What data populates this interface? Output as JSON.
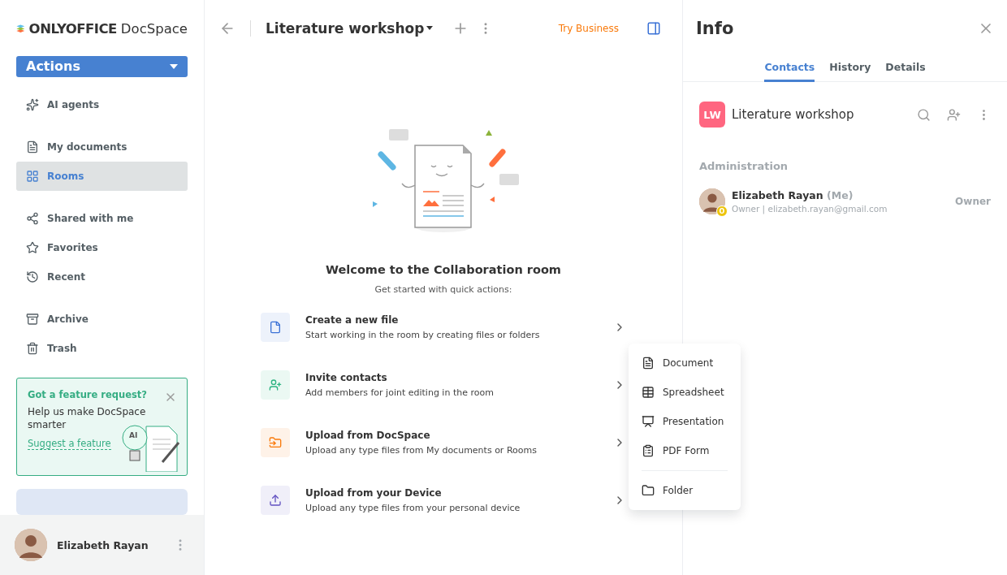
{
  "logo": {
    "brand": "ONLYOFFICE",
    "product": "DocSpace"
  },
  "actions_button": {
    "label": "Actions"
  },
  "sidebar": {
    "groups": [
      [
        {
          "label": "AI agents",
          "selected": false
        }
      ],
      [
        {
          "label": "My documents",
          "selected": false
        },
        {
          "label": "Rooms",
          "selected": true
        }
      ],
      [
        {
          "label": "Shared with me",
          "selected": false
        },
        {
          "label": "Favorites",
          "selected": false
        },
        {
          "label": "Recent",
          "selected": false
        }
      ],
      [
        {
          "label": "Archive",
          "selected": false
        },
        {
          "label": "Trash",
          "selected": false
        }
      ]
    ]
  },
  "feature_card": {
    "title": "Got a feature request?",
    "text": "Help us make DocSpace smarter",
    "link": "Suggest a feature",
    "badge": "AI"
  },
  "user": {
    "name": "Elizabeth Rayan"
  },
  "header": {
    "title": "Literature workshop",
    "try_business": "Try Business"
  },
  "empty_state": {
    "title": "Welcome to the Collaboration room",
    "subtitle": "Get started with quick actions:"
  },
  "quick_actions": [
    {
      "title": "Create a new file",
      "description": "Start working in the room by creating files or folders",
      "color": "#3b72d6"
    },
    {
      "title": "Invite contacts",
      "description": "Add members for joint editing in the room",
      "color": "#2db482"
    },
    {
      "title": "Upload from DocSpace",
      "description": "Upload any type files from My documents or Rooms",
      "color": "#f97a0b"
    },
    {
      "title": "Upload from your Device",
      "description": "Upload any type files from your personal device",
      "color": "#6251c1"
    }
  ],
  "new_file_menu": [
    {
      "label": "Document"
    },
    {
      "label": "Spreadsheet"
    },
    {
      "label": "Presentation"
    },
    {
      "label": "PDF Form"
    },
    {
      "label": "Folder"
    }
  ],
  "info_panel": {
    "title": "Info",
    "tabs": [
      {
        "label": "Contacts",
        "selected": true
      },
      {
        "label": "History",
        "selected": false
      },
      {
        "label": "Details",
        "selected": false
      }
    ],
    "room": {
      "initials": "LW",
      "name": "Literature workshop",
      "color": "#ff6680"
    },
    "section": "Administration",
    "members": [
      {
        "name": "Elizabeth Rayan",
        "me": "(Me)",
        "details": "Owner | elizabeth.rayan@gmail.com",
        "role": "Owner",
        "badge": "O"
      }
    ]
  }
}
